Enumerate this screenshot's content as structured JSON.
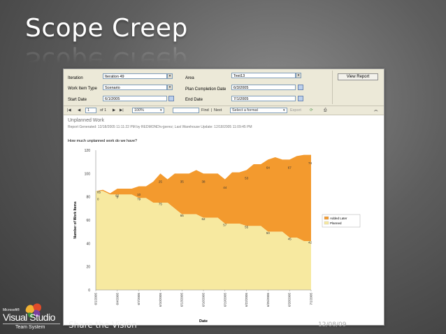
{
  "slide": {
    "title": "Scope Creep",
    "footer_text": "Share the Vision",
    "date": "12/08/09"
  },
  "logo": {
    "microsoft": "Microsoft®",
    "product": "Visual Studio",
    "edition": "Team System"
  },
  "params": {
    "iteration_label": "Iteration",
    "iteration_value": "Iteration 49",
    "work_item_type_label": "Work Item Type",
    "work_item_type_value": "Scenario",
    "start_date_label": "Start Date",
    "start_date_value": "6/1/2005",
    "area_label": "Area",
    "area_value": "Test13",
    "plan_completion_label": "Plan Completion Date",
    "plan_completion_value": "6/3/2005",
    "end_date_label": "End Date",
    "end_date_value": "7/1/2005",
    "view_report_label": "View Report"
  },
  "toolbar": {
    "page_current": "1",
    "page_of": "of 1",
    "zoom": "100%",
    "find_label": "Find",
    "next_label": "Next",
    "separator": "|",
    "format_select": "Select a format",
    "export_label": "Export"
  },
  "report": {
    "title": "Unplanned Work",
    "generated": "Report Generated: 12/18/2005 11:11:22 PM by REDMOND\\v-jperez; Last Warehouse Update: 12/18/2005 11:09:45 PM",
    "question": "How much unplanned work do we have?"
  },
  "chart_data": {
    "type": "area",
    "title": "",
    "xlabel": "Date",
    "ylabel": "Number of Work Items",
    "ylim": [
      0,
      120
    ],
    "yticks": [
      0,
      20,
      40,
      60,
      80,
      100,
      120
    ],
    "grid": false,
    "legend_position": "right",
    "x_tick_labels": [
      "6/1/2005",
      "6/4/2005",
      "6/7/2005",
      "6/10/2005",
      "6/13/2005",
      "6/16/2005",
      "6/19/2005",
      "6/22/2005",
      "6/25/2005",
      "6/28/2005",
      "7/1/2005"
    ],
    "x": [
      "6/1/2005",
      "6/2/2005",
      "6/3/2005",
      "6/4/2005",
      "6/5/2005",
      "6/6/2005",
      "6/7/2005",
      "6/8/2005",
      "6/9/2005",
      "6/10/2005",
      "6/11/2005",
      "6/12/2005",
      "6/13/2005",
      "6/14/2005",
      "6/15/2005",
      "6/16/2005",
      "6/17/2005",
      "6/18/2005",
      "6/19/2005",
      "6/20/2005",
      "6/21/2005",
      "6/22/2005",
      "6/23/2005",
      "6/24/2005",
      "6/25/2005",
      "6/26/2005",
      "6/27/2005",
      "6/28/2005",
      "6/29/2005",
      "6/30/2005",
      "7/1/2005"
    ],
    "series": [
      {
        "name": "Planned",
        "color": "#f7e9a0",
        "values": [
          85,
          85,
          82,
          82,
          82,
          82,
          79,
          79,
          75,
          75,
          75,
          70,
          65,
          65,
          65,
          62,
          62,
          62,
          57,
          57,
          57,
          55,
          55,
          55,
          50,
          50,
          50,
          45,
          45,
          42,
          42
        ]
      },
      {
        "name": "Added Later",
        "color": "#f39a2e",
        "values": [
          0,
          1,
          1,
          5,
          5,
          5,
          10,
          10,
          18,
          25,
          20,
          30,
          35,
          35,
          38,
          38,
          38,
          38,
          38,
          44,
          44,
          48,
          53,
          53,
          62,
          64,
          62,
          67,
          70,
          74,
          74
        ]
      }
    ],
    "data_labels": [
      {
        "series": "Planned",
        "x": "6/1/2005",
        "value": 85
      },
      {
        "series": "Planned",
        "x": "6/4/2005",
        "value": 82
      },
      {
        "series": "Planned",
        "x": "6/7/2005",
        "value": 79
      },
      {
        "series": "Planned",
        "x": "6/10/2005",
        "value": 75
      },
      {
        "series": "Planned",
        "x": "6/13/2005",
        "value": 65
      },
      {
        "series": "Planned",
        "x": "6/16/2005",
        "value": 62
      },
      {
        "series": "Planned",
        "x": "6/19/2005",
        "value": 57
      },
      {
        "series": "Planned",
        "x": "6/22/2005",
        "value": 55
      },
      {
        "series": "Planned",
        "x": "6/25/2005",
        "value": 50
      },
      {
        "series": "Planned",
        "x": "6/28/2005",
        "value": 45
      },
      {
        "series": "Planned",
        "x": "7/1/2005",
        "value": 42
      },
      {
        "series": "Added Later",
        "x": "6/1/2005",
        "value": 0
      },
      {
        "series": "Added Later",
        "x": "6/4/2005",
        "value": 5
      },
      {
        "series": "Added Later",
        "x": "6/7/2005",
        "value": 10
      },
      {
        "series": "Added Later",
        "x": "6/10/2005",
        "value": 25
      },
      {
        "series": "Added Later",
        "x": "6/13/2005",
        "value": 35
      },
      {
        "series": "Added Later",
        "x": "6/16/2005",
        "value": 38
      },
      {
        "series": "Added Later",
        "x": "6/19/2005",
        "value": 44
      },
      {
        "series": "Added Later",
        "x": "6/22/2005",
        "value": 53
      },
      {
        "series": "Added Later",
        "x": "6/25/2005",
        "value": 64
      },
      {
        "series": "Added Later",
        "x": "6/28/2005",
        "value": 67
      },
      {
        "series": "Added Later",
        "x": "7/1/2005",
        "value": 74
      }
    ]
  }
}
